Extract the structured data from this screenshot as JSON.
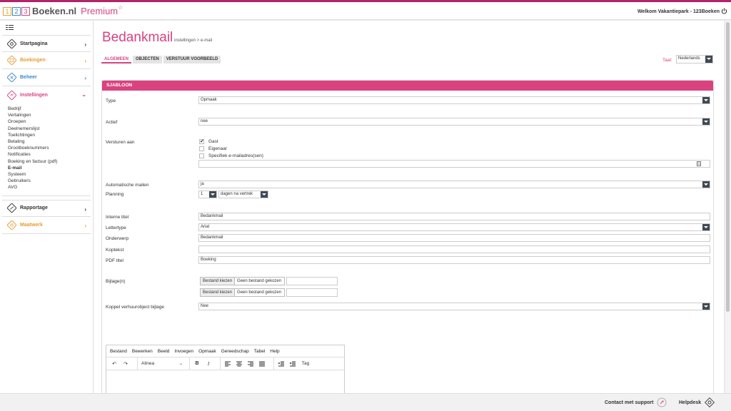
{
  "header": {
    "logo_digits": [
      "1",
      "2",
      "3"
    ],
    "logo_name": "Boeken.nl",
    "logo_premium": "Premium",
    "logo_star": "☆",
    "welcome": "Welkom Vakantiepark - 123Boeken"
  },
  "sidebar": {
    "items": [
      {
        "label": "Startpagina",
        "icon": "home-icon",
        "color": "#333333"
      },
      {
        "label": "Boekingen",
        "icon": "calendar-icon",
        "color": "#e89b33"
      },
      {
        "label": "Beheer",
        "icon": "tools-icon",
        "color": "#3b87c8"
      },
      {
        "label": "Instellingen",
        "icon": "settings-icon",
        "color": "#d9427f"
      },
      {
        "label": "Rapportage",
        "icon": "chart-icon",
        "color": "#333333"
      },
      {
        "label": "Maatwerk",
        "icon": "custom-icon",
        "color": "#e89b33"
      }
    ],
    "sub_items": [
      "Bedrijf",
      "Vertalingen",
      "Groepen",
      "Deelnemerslijst",
      "Toelichtingen",
      "Betaling",
      "Grootboeknummers",
      "Notificaties",
      "Boeking en factuur (pdf)",
      "E-mail",
      "Systeem",
      "Gebruikers",
      "AVG"
    ]
  },
  "page": {
    "title": "Bedankmail",
    "breadcrumb": "instellingen > e-mail",
    "tabs": [
      "ALGEMEEN",
      "OBJECTEN",
      "VERSTUUR VOORBEELD"
    ],
    "taal_label": "Taal:",
    "taal_value": "Nederlands"
  },
  "panel": {
    "title": "SJABLOON",
    "type_label": "Type",
    "type_value": "Opmaak",
    "actief_label": "Actief",
    "actief_value": "nee",
    "versturen_label": "Versturen aan",
    "cb_gast": "Gast",
    "cb_eigenaar": "Eigenaar",
    "cb_specifiek": "Specifiek e-mailadres(sen)",
    "auto_label": "Automatische mailen",
    "auto_value": "ja",
    "planning_label": "Planning",
    "planning_num": "1",
    "planning_unit": "dagen na vertrek",
    "interne_label": "Interne titel",
    "interne_value": "Bedankmail",
    "lettertype_label": "Lettertype",
    "lettertype_value": "Arial",
    "onderwerp_label": "Onderwerp",
    "onderwerp_value": "Bedankmail",
    "koptekst_label": "Koptekst",
    "koptekst_value": "",
    "pdf_label": "PDF titel",
    "pdf_value": "Boeking",
    "bijlage_label": "Bijlage(n)",
    "file_button": "Bestand kiezen",
    "file_none": "Geen bestand gekozen",
    "koppel_label": "Koppel verhuurobject bijlage",
    "koppel_value": "Nee"
  },
  "editor": {
    "menu": [
      "Bestand",
      "Bewerken",
      "Beeld",
      "Invoegen",
      "Opmaak",
      "Gereedschap",
      "Tabel",
      "Help"
    ],
    "paragraph": "Alinea",
    "bold": "B",
    "italic": "I",
    "tag": "Tag"
  },
  "footer": {
    "support": "Contact met support",
    "helpdesk": "Helpdesk"
  }
}
